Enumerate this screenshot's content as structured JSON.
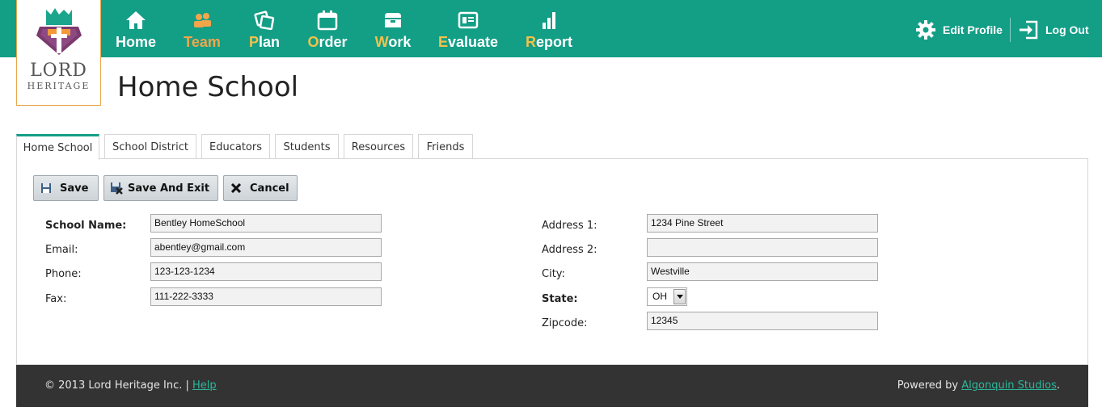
{
  "brand": {
    "line1": "LORD",
    "line2": "HERITAGE"
  },
  "nav": {
    "items": [
      {
        "label": "Home",
        "icon": "home-icon"
      },
      {
        "label": "Team",
        "icon": "team-icon",
        "active": true
      },
      {
        "label": "Plan",
        "icon": "plan-icon"
      },
      {
        "label": "Order",
        "icon": "order-icon"
      },
      {
        "label": "Work",
        "icon": "work-icon"
      },
      {
        "label": "Evaluate",
        "icon": "evaluate-icon"
      },
      {
        "label": "Report",
        "icon": "report-icon"
      }
    ]
  },
  "header_links": {
    "edit_profile": "Edit Profile",
    "log_out": "Log Out"
  },
  "page_title": "Home School",
  "tabs": [
    {
      "label": "Home School",
      "active": true
    },
    {
      "label": "School District"
    },
    {
      "label": "Educators"
    },
    {
      "label": "Students"
    },
    {
      "label": "Resources"
    },
    {
      "label": "Friends"
    }
  ],
  "toolbar": {
    "save_label": "Save",
    "save_exit_label": "Save And Exit",
    "cancel_label": "Cancel"
  },
  "form": {
    "school_name_label": "School Name:",
    "school_name_value": "Bentley HomeSchool",
    "email_label": "Email:",
    "email_value": "abentley@gmail.com",
    "phone_label": "Phone:",
    "phone_value": "123-123-1234",
    "fax_label": "Fax:",
    "fax_value": "111-222-3333",
    "address1_label": "Address 1:",
    "address1_value": "1234 Pine Street",
    "address2_label": "Address 2:",
    "address2_value": "",
    "city_label": "City:",
    "city_value": "Westville",
    "state_label": "State:",
    "state_value": "OH",
    "zipcode_label": "Zipcode:",
    "zipcode_value": "12345"
  },
  "footer": {
    "copyright": "© 2013 Lord Heritage Inc.  |",
    "help": "Help",
    "powered_by": "Powered by",
    "studio": "Algonquin Studios",
    "period": "."
  },
  "colors": {
    "primary": "#139e86",
    "accent": "#f3a54a",
    "footer_bg": "#333333"
  }
}
